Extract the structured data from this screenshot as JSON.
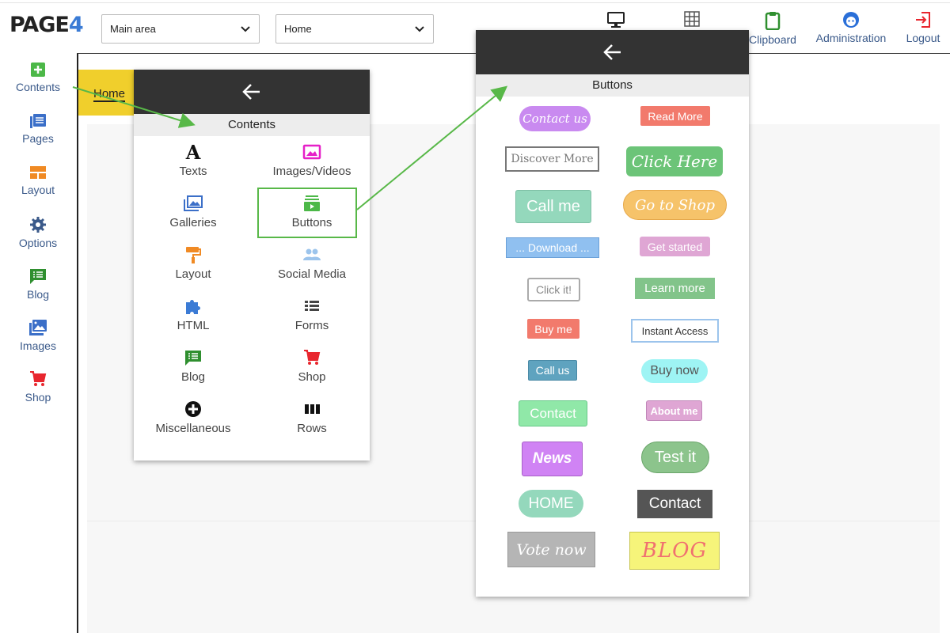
{
  "logo": {
    "text": "PAGE",
    "number": "4"
  },
  "header": {
    "area_select": "Main area",
    "page_select": "Home",
    "tools": [
      {
        "label": "",
        "icon": "monitor-icon"
      },
      {
        "label": "",
        "icon": "grid-icon"
      },
      {
        "label": "Clipboard",
        "icon": "clipboard-icon"
      },
      {
        "label": "Administration",
        "icon": "user-icon"
      },
      {
        "label": "Logout",
        "icon": "logout-icon"
      }
    ]
  },
  "sidebar": {
    "items": [
      {
        "label": "Contents",
        "icon": "plus-square-icon",
        "color": "#4cb848"
      },
      {
        "label": "Pages",
        "icon": "pages-icon",
        "color": "#3b6fc8"
      },
      {
        "label": "Layout",
        "icon": "layout-icon",
        "color": "#f08a24"
      },
      {
        "label": "Options",
        "icon": "gear-icon",
        "color": "#3b5a8a"
      },
      {
        "label": "Blog",
        "icon": "blog-icon",
        "color": "#2f8f2f"
      },
      {
        "label": "Images",
        "icon": "images-icon",
        "color": "#3b6fc8"
      },
      {
        "label": "Shop",
        "icon": "cart-icon",
        "color": "#e8262e"
      }
    ]
  },
  "canvas": {
    "home_tab": "Home"
  },
  "contents_panel": {
    "title": "Contents",
    "items": [
      {
        "label": "Texts",
        "icon": "text-icon"
      },
      {
        "label": "Images/Videos",
        "icon": "image-icon"
      },
      {
        "label": "Galleries",
        "icon": "gallery-icon"
      },
      {
        "label": "Buttons",
        "icon": "button-icon"
      },
      {
        "label": "Layout",
        "icon": "paint-roller-icon"
      },
      {
        "label": "Social Media",
        "icon": "people-icon"
      },
      {
        "label": "HTML",
        "icon": "puzzle-icon"
      },
      {
        "label": "Forms",
        "icon": "form-list-icon"
      },
      {
        "label": "Blog",
        "icon": "blog-icon"
      },
      {
        "label": "Shop",
        "icon": "cart-icon"
      },
      {
        "label": "Miscellaneous",
        "icon": "plus-circle-icon"
      },
      {
        "label": "Rows",
        "icon": "rows-icon"
      }
    ]
  },
  "buttons_panel": {
    "title": "Buttons",
    "buttons": [
      "Contact us",
      "Read More",
      "Discover More",
      "Click Here",
      "Call me",
      "Go to Shop",
      "... Download ...",
      "Get started",
      "Click it!",
      "Learn more",
      "Buy me",
      "Instant Access",
      "Call us",
      "Buy now",
      "Contact",
      "About me",
      "News",
      "Test it",
      "HOME",
      "Contact",
      "Vote now",
      "BLOG"
    ]
  },
  "colors": {
    "accent_green": "#58b848",
    "panel_header": "#333333",
    "home_tab": "#f0cf2c"
  }
}
